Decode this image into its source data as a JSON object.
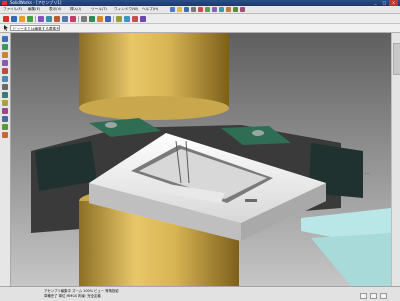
{
  "window": {
    "title": "SolidWorks - [アセンブリ1]",
    "minimize_icon": "minimize-icon",
    "maximize_icon": "maximize-icon",
    "close_icon": "close-icon"
  },
  "menubar": {
    "items": [
      "ファイル(F)",
      "編集(E)",
      "表示(V)",
      "挿入(I)",
      "ツール(T)",
      "ウィンドウ(W)",
      "ヘルプ(H)"
    ]
  },
  "cmdbar": {
    "field_value": "ビューまたは編集する要素を選択"
  },
  "statusbar": {
    "line1": "アセンブリ編集中   ズーム 100%   ビュー 等角投影",
    "line2": "準備完了   単位 MMGS   拘束: 完全定義"
  },
  "colors": {
    "background_top": "#6e6e6e",
    "background_bottom": "#bdbdbd",
    "cylinder": "#d9b75a",
    "plate": "#f0f0f0",
    "dark_block": "#1f3230",
    "teal_strip": "#b9e6e6",
    "green_clamp": "#2f6d55"
  }
}
